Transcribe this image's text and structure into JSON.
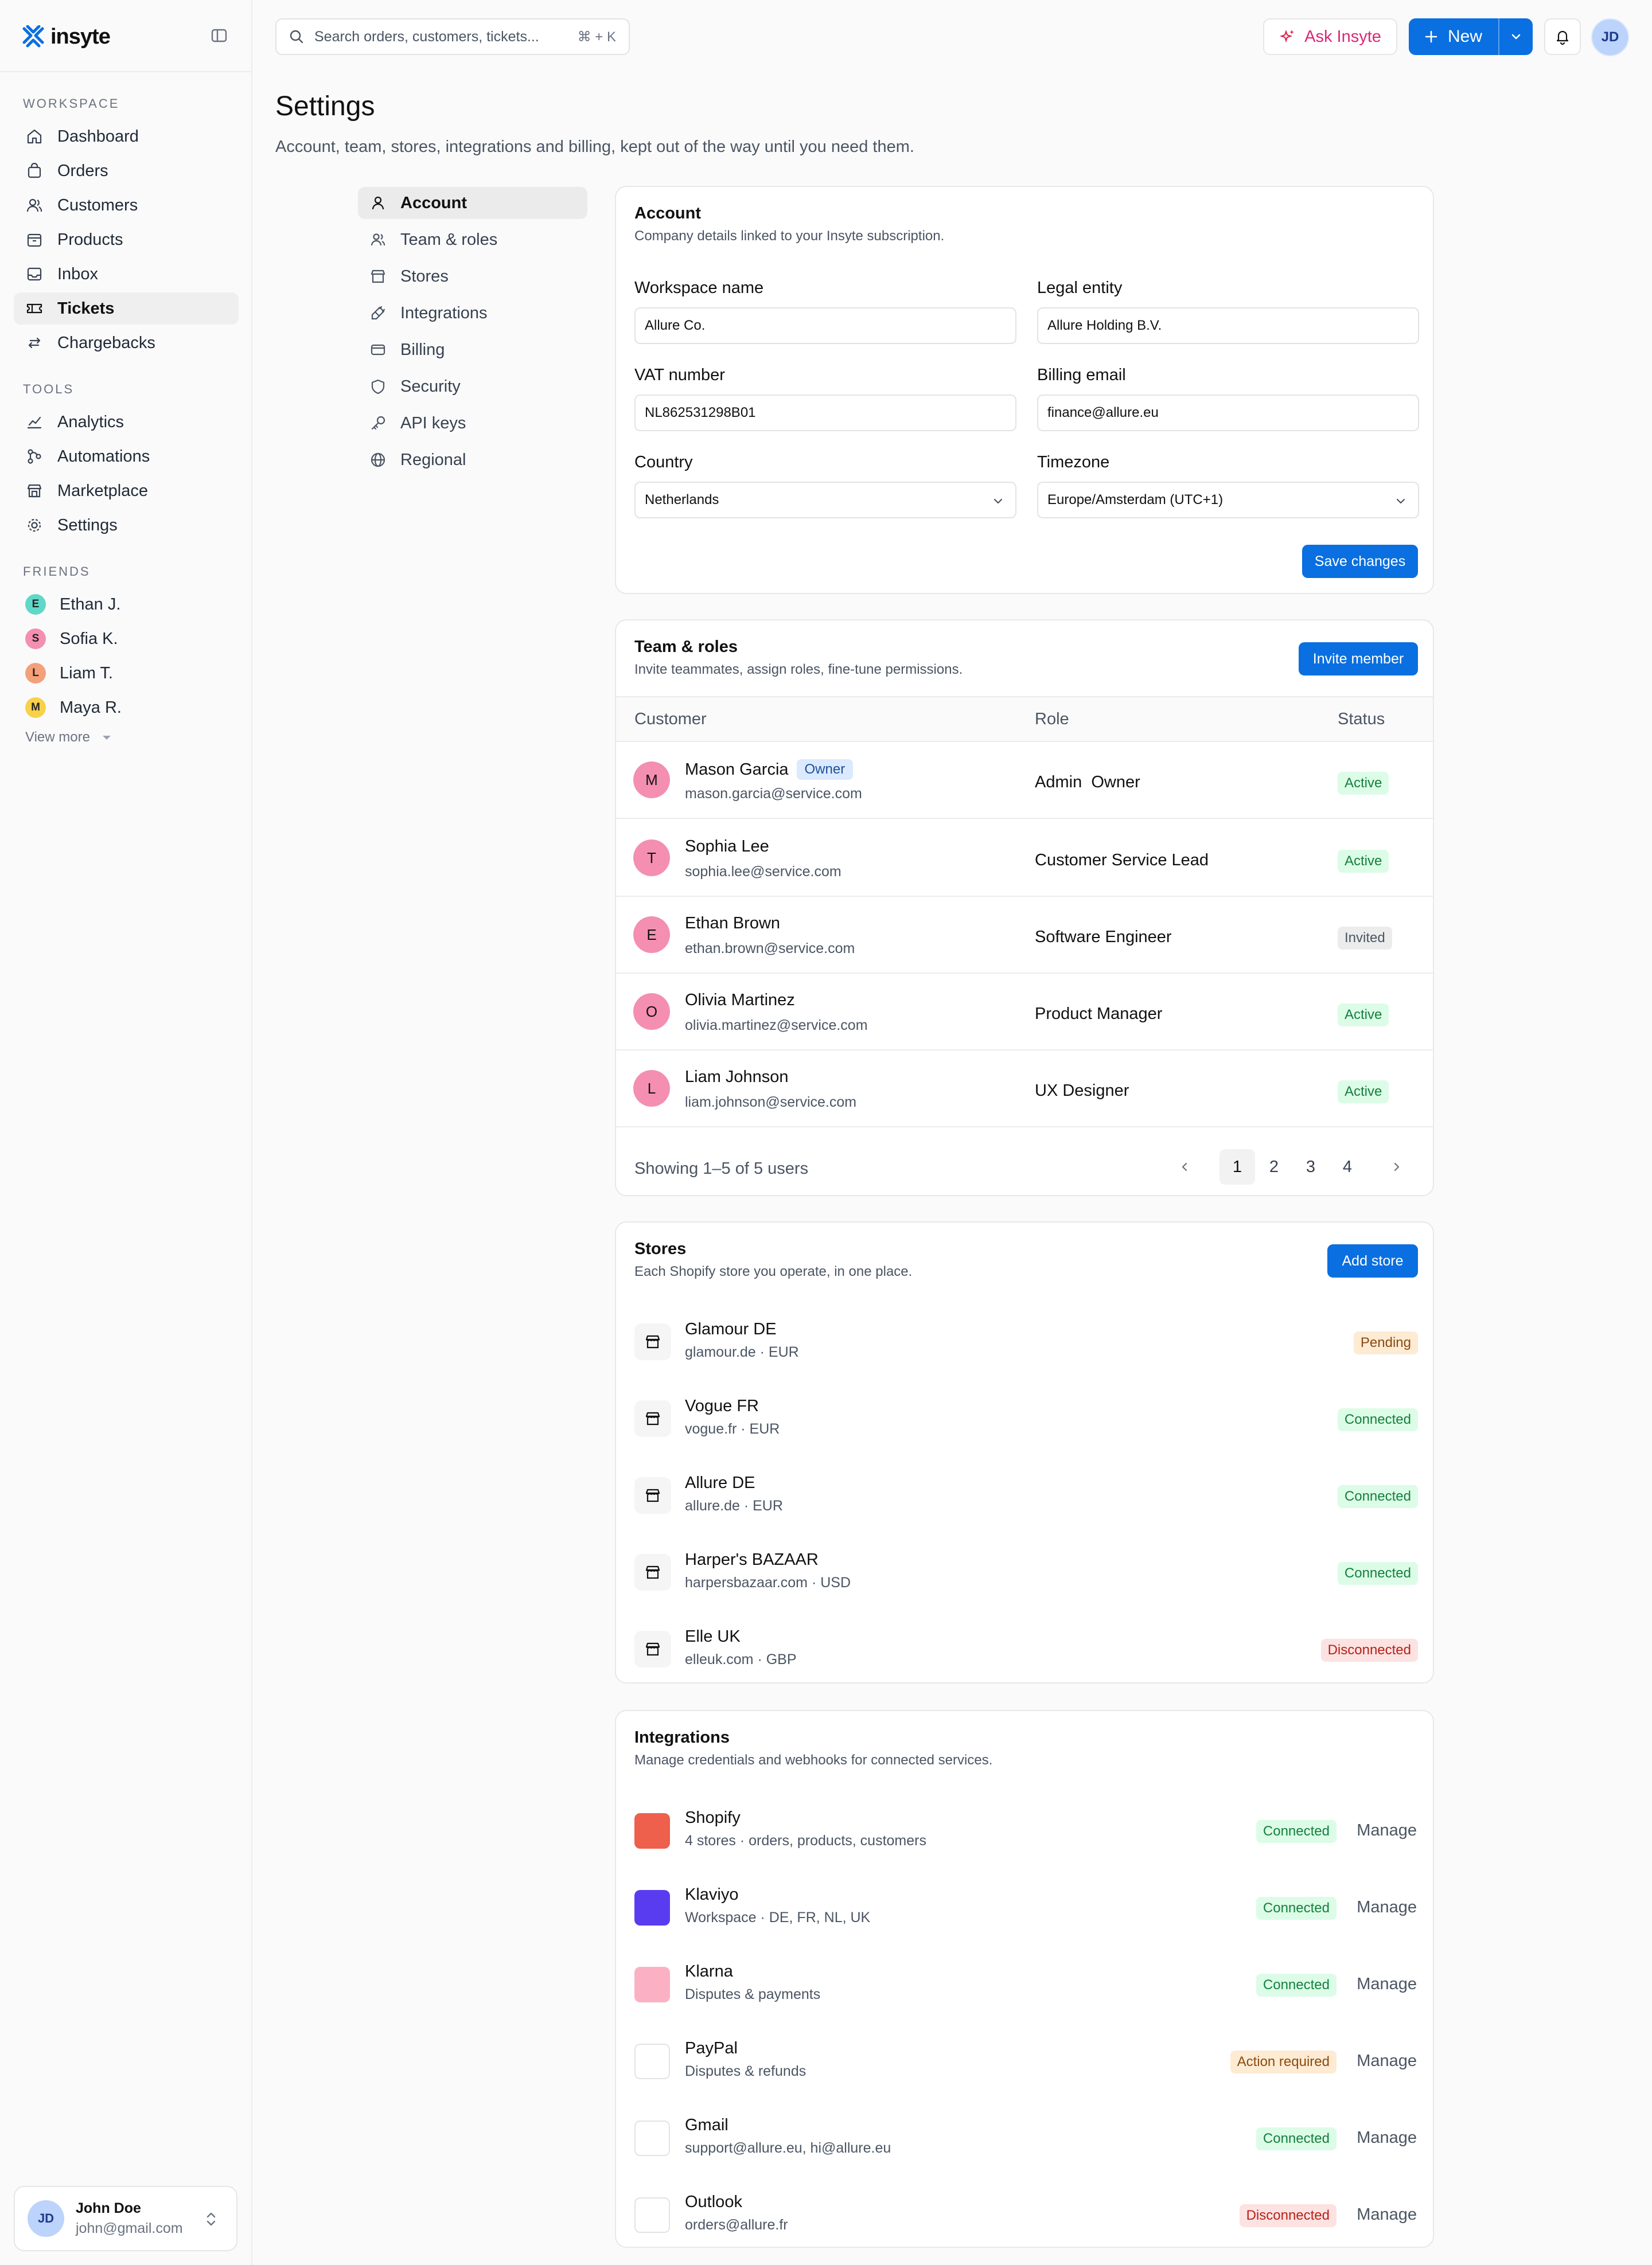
{
  "app": {
    "brand": "insyte"
  },
  "sidebar": {
    "workspace_label": "WORKSPACE",
    "workspace_items": [
      {
        "label": "Dashboard",
        "icon": "home-icon"
      },
      {
        "label": "Orders",
        "icon": "bag-icon"
      },
      {
        "label": "Customers",
        "icon": "users-icon"
      },
      {
        "label": "Products",
        "icon": "package-icon"
      },
      {
        "label": "Inbox",
        "icon": "inbox-icon"
      },
      {
        "label": "Tickets",
        "icon": "ticket-icon",
        "active": true
      },
      {
        "label": "Chargebacks",
        "icon": "refund-icon"
      }
    ],
    "tools_label": "TOOLS",
    "tools_items": [
      {
        "label": "Analytics",
        "icon": "analytics-icon"
      },
      {
        "label": "Automations",
        "icon": "automation-icon"
      },
      {
        "label": "Marketplace",
        "icon": "store-icon"
      },
      {
        "label": "Settings",
        "icon": "gear-icon"
      }
    ],
    "friends_label": "FRIENDS",
    "friends": [
      {
        "initial": "E",
        "name": "Ethan J.",
        "color": "#5fd8c8"
      },
      {
        "initial": "S",
        "name": "Sofia K.",
        "color": "#f48fb1"
      },
      {
        "initial": "L",
        "name": "Liam T.",
        "color": "#f4a07a"
      },
      {
        "initial": "M",
        "name": "Maya R.",
        "color": "#f7d14a"
      }
    ],
    "view_more": "View more",
    "user": {
      "initials": "JD",
      "name": "John Doe",
      "email": "john@gmail.com"
    }
  },
  "topbar": {
    "search_placeholder": "Search orders, customers, tickets...",
    "search_shortcut": "⌘ + K",
    "ask_label": "Ask Insyte",
    "new_label": "New",
    "avatar_initials": "JD"
  },
  "page": {
    "title": "Settings",
    "subtitle": "Account, team, stores, integrations and billing, kept out of the way until you need them."
  },
  "settings_nav": [
    {
      "label": "Account",
      "icon": "user-icon",
      "active": true
    },
    {
      "label": "Team & roles",
      "icon": "team-icon"
    },
    {
      "label": "Stores",
      "icon": "store-icon"
    },
    {
      "label": "Integrations",
      "icon": "plug-icon"
    },
    {
      "label": "Billing",
      "icon": "credit-card-icon"
    },
    {
      "label": "Security",
      "icon": "shield-icon"
    },
    {
      "label": "API keys",
      "icon": "key-icon"
    },
    {
      "label": "Regional",
      "icon": "globe-icon"
    }
  ],
  "account": {
    "title": "Account",
    "desc": "Company details linked to your Insyte subscription.",
    "workspace_label": "Workspace name",
    "workspace_value": "Allure Co.",
    "legal_label": "Legal entity",
    "legal_value": "Allure Holding B.V.",
    "vat_label": "VAT number",
    "vat_value": "NL862531298B01",
    "billing_label": "Billing email",
    "billing_value": "finance@allure.eu",
    "country_label": "Country",
    "country_value": "Netherlands",
    "timezone_label": "Timezone",
    "timezone_value": "Europe/Amsterdam (UTC+1)",
    "save_label": "Save changes"
  },
  "team": {
    "title": "Team & roles",
    "desc": "Invite teammates, assign roles, fine-tune permissions.",
    "invite_label": "Invite member",
    "columns": [
      "Customer",
      "Role",
      "Status"
    ],
    "members": [
      {
        "initial": "M",
        "name": "Mason Garcia",
        "tag": "Owner",
        "email": "mason.garcia@service.com",
        "role": "Admin  Owner",
        "status": "Active"
      },
      {
        "initial": "T",
        "name": "Sophia Lee",
        "email": "sophia.lee@service.com",
        "role": "Customer Service Lead",
        "status": "Active"
      },
      {
        "initial": "E",
        "name": "Ethan Brown",
        "email": "ethan.brown@service.com",
        "role": "Software Engineer",
        "status": "Invited"
      },
      {
        "initial": "O",
        "name": "Olivia Martinez",
        "email": "olivia.martinez@service.com",
        "role": "Product Manager",
        "status": "Active"
      },
      {
        "initial": "L",
        "name": "Liam Johnson",
        "email": "liam.johnson@service.com",
        "role": "UX Designer",
        "status": "Active"
      }
    ],
    "showing": "Showing 1–5 of 5 users",
    "pages": [
      "1",
      "2",
      "3",
      "4"
    ]
  },
  "stores": {
    "title": "Stores",
    "desc": "Each Shopify store you operate, in one place.",
    "add_label": "Add store",
    "items": [
      {
        "name": "Glamour DE",
        "sub": "glamour.de · EUR",
        "status": "Pending"
      },
      {
        "name": "Vogue FR",
        "sub": "vogue.fr · EUR",
        "status": "Connected"
      },
      {
        "name": "Allure DE",
        "sub": "allure.de · EUR",
        "status": "Connected"
      },
      {
        "name": "Harper's BAZAAR",
        "sub": "harpersbazaar.com · USD",
        "status": "Connected"
      },
      {
        "name": "Elle UK",
        "sub": "elleuk.com · GBP",
        "status": "Disconnected"
      }
    ]
  },
  "integrations": {
    "title": "Integrations",
    "desc": "Manage credentials and webhooks for connected services.",
    "manage_label": "Manage",
    "items": [
      {
        "name": "Shopify",
        "sub": "4 stores · orders, products, customers",
        "status": "Connected",
        "color": "#ee5f4c"
      },
      {
        "name": "Klaviyo",
        "sub": "Workspace · DE, FR, NL, UK",
        "status": "Connected",
        "color": "#5a3cf0"
      },
      {
        "name": "Klarna",
        "sub": "Disputes & payments",
        "status": "Connected",
        "color": "#fbb1c3"
      },
      {
        "name": "PayPal",
        "sub": "Disputes & refunds",
        "status": "Action required",
        "color": "#ffffff"
      },
      {
        "name": "Gmail",
        "sub": "support@allure.eu, hi@allure.eu",
        "status": "Connected",
        "color": "#ffffff"
      },
      {
        "name": "Outlook",
        "sub": "orders@allure.fr",
        "status": "Disconnected",
        "color": "#ffffff"
      }
    ]
  }
}
